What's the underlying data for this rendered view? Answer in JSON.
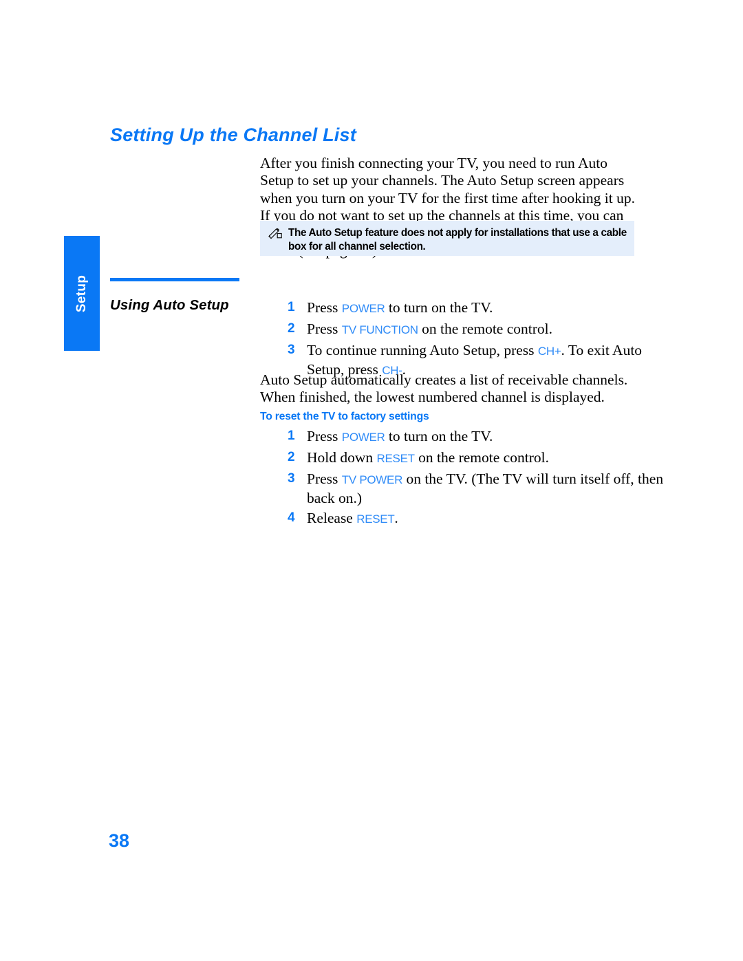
{
  "page": {
    "number": "38",
    "section_tab_label": "Setup",
    "title": "Setting Up the Channel List"
  },
  "intro": {
    "paragraph": "After you finish connecting your TV, you need to run Auto Setup to set up your channels. The Auto Setup screen appears when you turn on your TV for the first time after hooking it up. If you do not want to set up the channels at this time, you can do it later by selecting the Auto Program option in the Channel Menu (see page 66)."
  },
  "note": {
    "icon": "note-pencil-icon",
    "text": "The Auto Setup feature does not apply for installations that use a cable box for all channel selection."
  },
  "auto_setup": {
    "heading": "Using Auto Setup",
    "steps": [
      {
        "num": "1",
        "parts": [
          {
            "t": "text",
            "v": "Press "
          },
          {
            "t": "btn",
            "v": "POWER"
          },
          {
            "t": "text",
            "v": " to turn on the TV."
          }
        ]
      },
      {
        "num": "2",
        "parts": [
          {
            "t": "text",
            "v": "Press "
          },
          {
            "t": "btn",
            "v": "TV FUNCTION"
          },
          {
            "t": "text",
            "v": " on the remote control."
          }
        ]
      },
      {
        "num": "3",
        "parts": [
          {
            "t": "text",
            "v": "To continue running Auto Setup, press "
          },
          {
            "t": "btn",
            "v": "CH+"
          },
          {
            "t": "text",
            "v": ". To exit Auto Setup, press "
          },
          {
            "t": "btn",
            "v": "CH-"
          },
          {
            "t": "text",
            "v": "."
          }
        ]
      }
    ]
  },
  "result": {
    "paragraph": "Auto Setup automatically creates a list of receivable channels. When finished, the lowest numbered channel is displayed."
  },
  "factory_reset": {
    "heading": "To reset the TV to factory settings",
    "steps": [
      {
        "num": "1",
        "parts": [
          {
            "t": "text",
            "v": "Press "
          },
          {
            "t": "btn",
            "v": "POWER"
          },
          {
            "t": "text",
            "v": " to turn on the TV."
          }
        ]
      },
      {
        "num": "2",
        "parts": [
          {
            "t": "text",
            "v": "Hold down "
          },
          {
            "t": "btn",
            "v": "RESET"
          },
          {
            "t": "text",
            "v": " on the remote control."
          }
        ]
      },
      {
        "num": "3",
        "parts": [
          {
            "t": "text",
            "v": "Press "
          },
          {
            "t": "btn",
            "v": "TV POWER"
          },
          {
            "t": "text",
            "v": " on the TV. (The TV will turn itself off, then back on.)"
          }
        ]
      },
      {
        "num": "4",
        "parts": [
          {
            "t": "text",
            "v": "Release "
          },
          {
            "t": "btn",
            "v": "RESET"
          },
          {
            "t": "text",
            "v": "."
          }
        ]
      }
    ]
  },
  "colors": {
    "accent_blue": "#0a78f5",
    "token_blue": "#2f8bf7",
    "note_background": "#e4eefb"
  }
}
